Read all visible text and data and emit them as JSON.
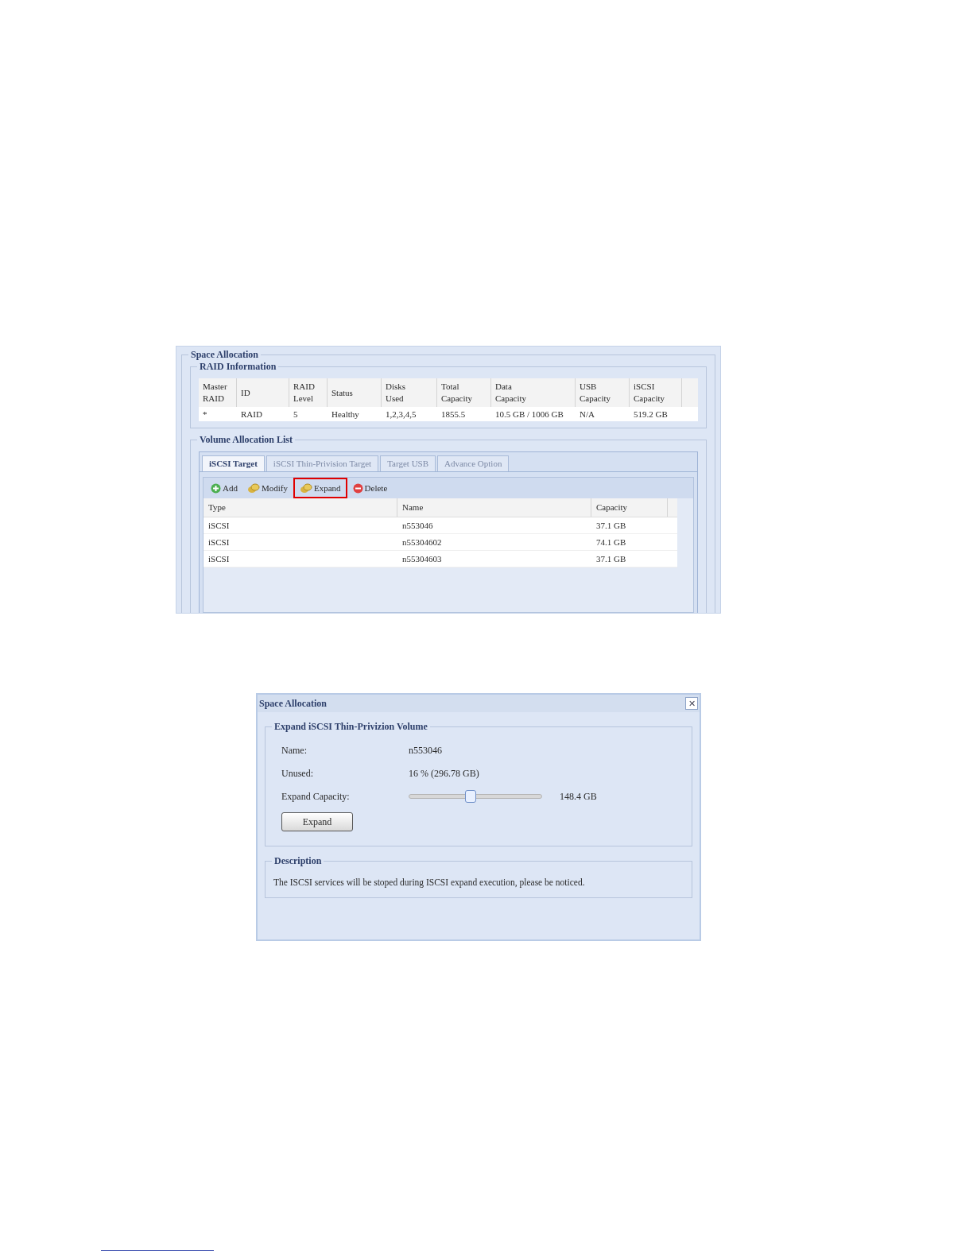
{
  "space_allocation_screen": {
    "title": "Space Allocation",
    "raid_information": {
      "title": "RAID Information",
      "columns": [
        "Master RAID",
        "ID",
        "RAID Level",
        "Status",
        "Disks Used",
        "Total Capacity",
        "Data Capacity",
        "USB Capacity",
        "iSCSI Capacity"
      ],
      "rows": [
        [
          "*",
          "RAID",
          "5",
          "Healthy",
          "1,2,3,4,5",
          "1855.5",
          "10.5 GB / 1006 GB",
          "N/A",
          "519.2 GB"
        ]
      ]
    },
    "volume_allocation_list": {
      "title": "Volume Allocation List",
      "tabs": [
        {
          "label": "iSCSI Target",
          "selected": true
        },
        {
          "label": "iSCSI Thin-Privision Target",
          "selected": false
        },
        {
          "label": "Target USB",
          "selected": false
        },
        {
          "label": "Advance Option",
          "selected": false
        }
      ],
      "toolbar": [
        {
          "kind": "add",
          "label": "Add",
          "highlighted": false
        },
        {
          "kind": "modify",
          "label": "Modify",
          "highlighted": false
        },
        {
          "kind": "expand",
          "label": "Expand",
          "highlighted": true
        },
        {
          "kind": "delete",
          "label": "Delete",
          "highlighted": false
        }
      ],
      "columns": [
        "Type",
        "Name",
        "Capacity"
      ],
      "rows": [
        [
          "iSCSI",
          "n553046",
          "37.1 GB"
        ],
        [
          "iSCSI",
          "n55304602",
          "74.1 GB"
        ],
        [
          "iSCSI",
          "n55304603",
          "37.1 GB"
        ]
      ]
    }
  },
  "expand_dialog": {
    "title": "Space Allocation",
    "close": "✕",
    "section_title": "Expand iSCSI Thin-Privizion Volume",
    "fields": [
      {
        "label": "Name:",
        "value": "n553046"
      },
      {
        "label": "Unused:",
        "value": "16 % (296.78 GB)"
      }
    ],
    "slider": {
      "label": "Expand Capacity:",
      "level": 0.46,
      "reading": "148.4 GB"
    },
    "button": "Expand",
    "description": {
      "title": "Description",
      "text": "The ISCSI services will be stoped during ISCSI expand execution, please be noticed."
    }
  }
}
